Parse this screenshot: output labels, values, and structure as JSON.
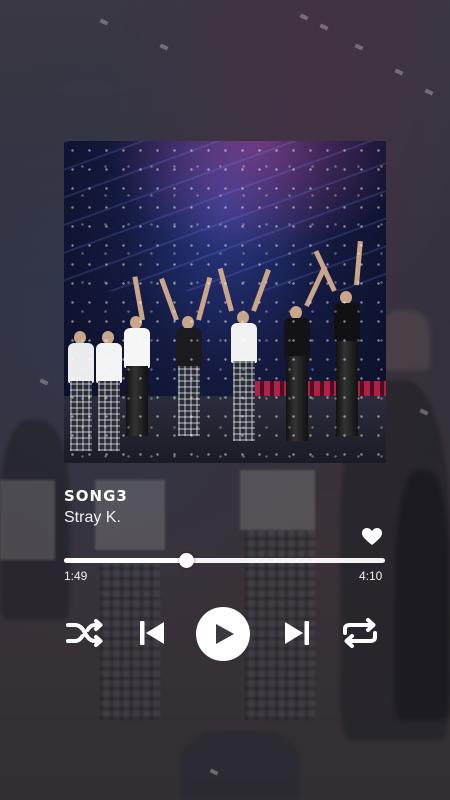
{
  "player": {
    "song_title": "SONG3",
    "artist": "Stray K.",
    "elapsed": "1:49",
    "total": "4:10",
    "progress_fraction": 0.38,
    "liked": true
  },
  "controls": {
    "shuffle_icon": "shuffle-icon",
    "prev_icon": "skip-previous-icon",
    "play_icon": "play-icon",
    "next_icon": "skip-next-icon",
    "repeat_icon": "repeat-icon",
    "like_icon": "heart-icon"
  },
  "colors": {
    "foreground": "#ffffff",
    "play_glyph": "#3a3a42"
  }
}
